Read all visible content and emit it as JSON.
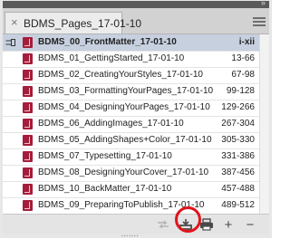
{
  "panel": {
    "tab_title": "BDMS_Pages_17-01-10",
    "tab_close_glyph": "×",
    "collapse_glyph": "»"
  },
  "documents": [
    {
      "name": "BDMS_00_FrontMatter_17-01-10",
      "pages": "i-xii",
      "selected": true,
      "synced": true
    },
    {
      "name": "BDMS_01_GettingStarted_17-01-10",
      "pages": "13-66"
    },
    {
      "name": "BDMS_02_CreatingYourStyles_17-01-10",
      "pages": "67-98"
    },
    {
      "name": "BDMS_03_FormattingYourPages_17-01-10",
      "pages": "99-128"
    },
    {
      "name": "BDMS_04_DesigningYourPages_17-01-10",
      "pages": "129-266"
    },
    {
      "name": "BDMS_06_AddingImages_17-01-10",
      "pages": "267-304"
    },
    {
      "name": "BDMS_05_AddingShapes+Color_17-01-10",
      "pages": "305-330"
    },
    {
      "name": "BDMS_07_Typesetting_17-01-10",
      "pages": "331-386"
    },
    {
      "name": "BDMS_08_DesigningYourCover_17-01-10",
      "pages": "387-456"
    },
    {
      "name": "BDMS_10_BackMatter_17-01-10",
      "pages": "457-488"
    },
    {
      "name": "BDMS_09_PreparingToPublish_17-01-10",
      "pages": "489-512"
    }
  ],
  "toolbar": {
    "sync_icon": "sync-styles-icon",
    "save_icon": "save-book-icon",
    "print_icon": "print-book-icon",
    "add_glyph": "+",
    "remove_glyph": "−",
    "highlight_color": "#e1141c"
  },
  "colors": {
    "selected_row": "#c7d0df",
    "file_icon": "#a51d3a"
  }
}
